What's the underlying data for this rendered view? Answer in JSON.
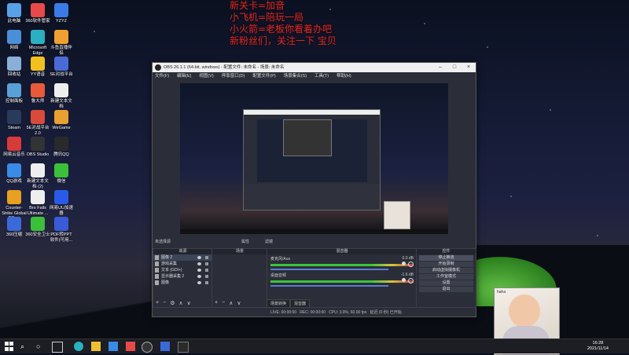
{
  "desktop_icons": [
    {
      "label": "此电脑",
      "color": "#5aa0e8"
    },
    {
      "label": "360软件管家",
      "color": "#e84a4a"
    },
    {
      "label": "YZYZ",
      "color": "#3b7be8"
    },
    {
      "label": "网络",
      "color": "#4a90d8"
    },
    {
      "label": "Microsoft Edge",
      "color": "#2ab0c0"
    },
    {
      "label": "斗鱼直播伴侣",
      "color": "#f0a030"
    },
    {
      "label": "回收站",
      "color": "#8ab0d8"
    },
    {
      "label": "YY语音",
      "color": "#f0c020"
    },
    {
      "label": "SE对战平台",
      "color": "#4a6ad8"
    },
    {
      "label": "控制面板",
      "color": "#5aa0d8"
    },
    {
      "label": "鲁大师",
      "color": "#e85a3a"
    },
    {
      "label": "新建文本文档",
      "color": "#eeeeee"
    },
    {
      "label": "Steam",
      "color": "#2a3a5a"
    },
    {
      "label": "5E对战平台 2.0",
      "color": "#d84a3a"
    },
    {
      "label": "WeGame",
      "color": "#e8a030"
    },
    {
      "label": "网易云音乐",
      "color": "#d83a3a"
    },
    {
      "label": "OBS Studio",
      "color": "#333333"
    },
    {
      "label": "腾讯QQ",
      "color": "#2a2a2a"
    },
    {
      "label": "QQ游戏",
      "color": "#3a8ae8"
    },
    {
      "label": "新建文本文档 (2)",
      "color": "#eeeeee"
    },
    {
      "label": "微信",
      "color": "#3ac03a"
    },
    {
      "label": "Counter-Strike Global Offe...",
      "color": "#e8a020"
    },
    {
      "label": "Bro Falls Ultimate ...",
      "color": "#eeeeee"
    },
    {
      "label": "网易UU加速器",
      "color": "#2a5ae8"
    },
    {
      "label": "360压缩",
      "color": "#3a6ad8"
    },
    {
      "label": "360安全卫士",
      "color": "#3ac03a"
    },
    {
      "label": "PDF转PPT软件(可用...",
      "color": "#3a5ad8"
    }
  ],
  "overlay_lines": [
    "新关卡=加音",
    "小飞机=陪玩一局",
    "小火箭=老板你看着办吧",
    "新粉丝们，关注一下 宝贝"
  ],
  "obs": {
    "title": "OBS 26.1.1 (64-bit, windows) - 配置文件: 未命名 - 场景: 未命名",
    "menu": [
      "文件(F)",
      "编辑(E)",
      "视图(V)",
      "停靠窗口(D)",
      "配置文件(P)",
      "场景集合(S)",
      "工具(T)",
      "帮助(H)"
    ],
    "no_source_selected": "未选择源",
    "properties_label": "属性",
    "filters_label": "滤镜",
    "scenes": {
      "header": "场景"
    },
    "sources": {
      "header": "来源",
      "items": [
        "图像 2",
        "游戏采集",
        "文本 (GDI+)",
        "显示器采集 2",
        "图像"
      ]
    },
    "mixer": {
      "header": "混音器",
      "channels": [
        {
          "name": "麦克风/Aux",
          "db": "0.0 dB"
        },
        {
          "name": "桌面音频",
          "db": "-1.6 dB"
        }
      ],
      "tabs": [
        "场景转换",
        "混音器"
      ]
    },
    "controls": {
      "header": "控件",
      "buttons": [
        "停止推流",
        "开始录制",
        "启动虚拟摄像机",
        "工作室模式",
        "设置",
        "退出"
      ]
    },
    "status": {
      "live": "LIVE: 00:00:00",
      "rec": "REC: 00:00:00",
      "cpu": "CPU: 3.9%, 60.00 fps",
      "extra": "延迟 (0 秒) 已开始"
    }
  },
  "webcam": {
    "label": "haha"
  },
  "taskbar": {
    "time": "16:28",
    "date": "2021/11/14"
  }
}
